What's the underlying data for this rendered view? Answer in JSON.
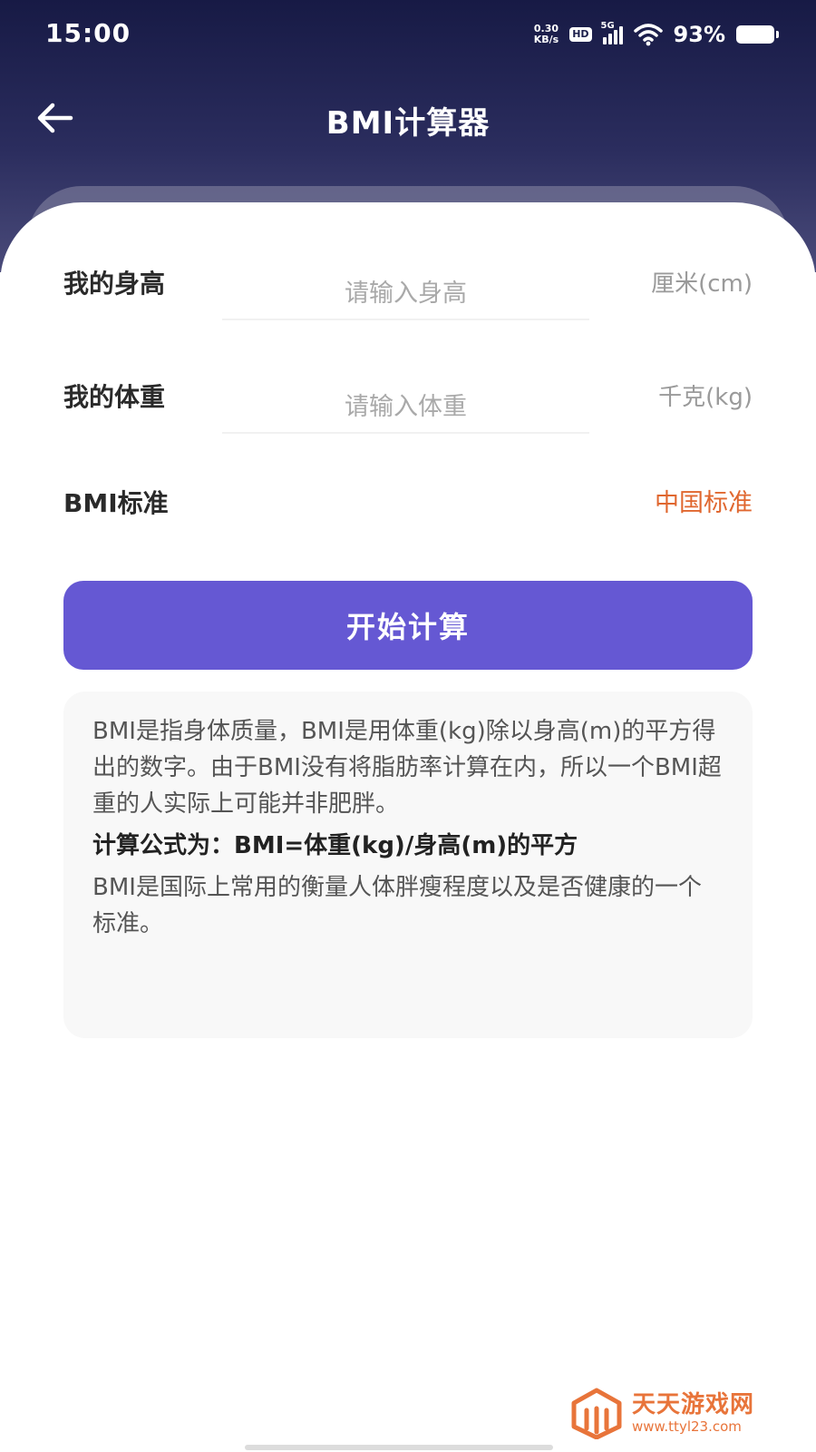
{
  "status_bar": {
    "time": "15:00",
    "net_speed_value": "0.30",
    "net_speed_unit": "KB/s",
    "hd": "HD",
    "network": "5G",
    "battery": "93%"
  },
  "nav": {
    "title": "BMI计算器",
    "back_icon": "arrow-left-icon"
  },
  "form": {
    "height": {
      "label": "我的身高",
      "placeholder": "请输入身高",
      "value": "",
      "unit": "厘米(cm)"
    },
    "weight": {
      "label": "我的体重",
      "placeholder": "请输入体重",
      "value": "",
      "unit": "千克(kg)"
    },
    "standard": {
      "label": "BMI标准",
      "value": "中国标准"
    }
  },
  "calculate_button": "开始计算",
  "info": {
    "paragraph1": "BMI是指身体质量，BMI是用体重(kg)除以身高(m)的平方得出的数字。由于BMI没有将脂肪率计算在内，所以一个BMI超重的人实际上可能并非肥胖。",
    "formula": "计算公式为：BMI=体重(kg)/身高(m)的平方",
    "paragraph2": "BMI是国际上常用的衡量人体胖瘦程度以及是否健康的一个标准。"
  },
  "watermark": {
    "title": "天天游戏网",
    "url": "www.ttyl23.com"
  },
  "colors": {
    "accent": "#6558d3",
    "header_dark": "#171a45",
    "standard_value": "#e0672f",
    "watermark": "#e8743a"
  }
}
